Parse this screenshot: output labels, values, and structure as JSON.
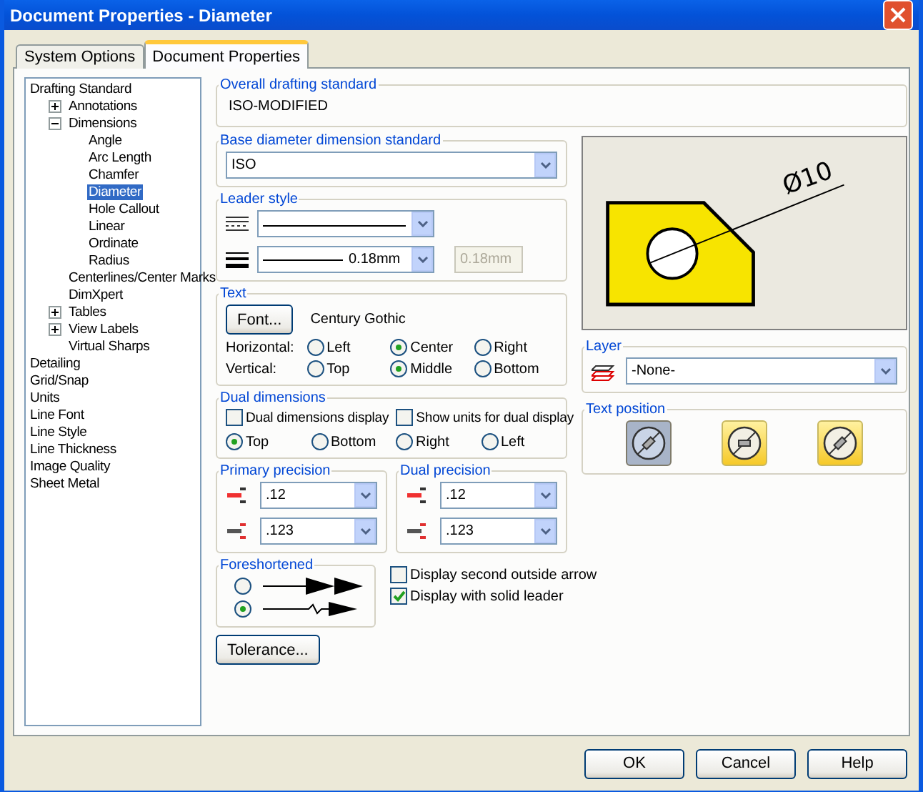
{
  "window": {
    "title": "Document Properties - Diameter"
  },
  "tabs": [
    {
      "label": "System Options",
      "selected": false
    },
    {
      "label": "Document Properties",
      "selected": true
    }
  ],
  "tree": [
    {
      "label": "Drafting Standard",
      "selected": false,
      "children": [
        {
          "label": "Annotations",
          "selected": false,
          "expanded": false
        },
        {
          "label": "Dimensions",
          "selected": false,
          "expanded": true,
          "children": [
            {
              "label": "Angle",
              "selected": false
            },
            {
              "label": "Arc Length",
              "selected": false
            },
            {
              "label": "Chamfer",
              "selected": false
            },
            {
              "label": "Diameter",
              "selected": true
            },
            {
              "label": "Hole Callout",
              "selected": false
            },
            {
              "label": "Linear",
              "selected": false
            },
            {
              "label": "Ordinate",
              "selected": false
            },
            {
              "label": "Radius",
              "selected": false
            }
          ]
        },
        {
          "label": "Centerlines/Center Marks",
          "selected": false
        },
        {
          "label": "DimXpert",
          "selected": false
        },
        {
          "label": "Tables",
          "selected": false,
          "expanded": false
        },
        {
          "label": "View Labels",
          "selected": false,
          "expanded": false
        },
        {
          "label": "Virtual Sharps",
          "selected": false
        }
      ]
    },
    {
      "label": "Detailing",
      "selected": false
    },
    {
      "label": "Grid/Snap",
      "selected": false
    },
    {
      "label": "Units",
      "selected": false
    },
    {
      "label": "Line Font",
      "selected": false
    },
    {
      "label": "Line Style",
      "selected": false
    },
    {
      "label": "Line Thickness",
      "selected": false
    },
    {
      "label": "Image Quality",
      "selected": false
    },
    {
      "label": "Sheet Metal",
      "selected": false
    }
  ],
  "overall_standard": {
    "label": "Overall drafting standard",
    "value": "ISO-MODIFIED"
  },
  "base_standard": {
    "label": "Base diameter dimension standard",
    "value": "ISO"
  },
  "leader_style": {
    "label": "Leader style",
    "thickness": "0.18mm",
    "custom_thickness": "0.18mm",
    "custom_disabled": true
  },
  "text": {
    "label": "Text",
    "font_button": "Font...",
    "font_name": "Century Gothic",
    "rows": [
      {
        "label": "Horizontal:",
        "options": [
          {
            "label": "Left",
            "selected": false
          },
          {
            "label": "Center",
            "selected": true
          },
          {
            "label": "Right",
            "selected": false
          }
        ]
      },
      {
        "label": "Vertical:",
        "options": [
          {
            "label": "Top",
            "selected": false
          },
          {
            "label": "Middle",
            "selected": true
          },
          {
            "label": "Bottom",
            "selected": false
          }
        ]
      }
    ]
  },
  "dual_dimensions": {
    "label": "Dual dimensions",
    "checkboxes": [
      {
        "label": "Dual dimensions display",
        "checked": false
      },
      {
        "label": "Show units for dual display",
        "checked": false
      }
    ],
    "options": [
      {
        "label": "Top",
        "selected": true
      },
      {
        "label": "Bottom",
        "selected": false
      },
      {
        "label": "Right",
        "selected": false
      },
      {
        "label": "Left",
        "selected": false
      }
    ]
  },
  "precision": [
    {
      "label": "Primary precision",
      "values": [
        ".12",
        ".123"
      ]
    },
    {
      "label": "Dual precision",
      "values": [
        ".12",
        ".123"
      ]
    }
  ],
  "foreshortened": {
    "label": "Foreshortened",
    "options": [
      {
        "kind": "straight",
        "selected": false
      },
      {
        "kind": "zigzag",
        "selected": true
      }
    ]
  },
  "arrow_options": [
    {
      "label": "Display second outside arrow",
      "checked": false
    },
    {
      "label": "Display with solid leader",
      "checked": true
    }
  ],
  "tolerance_button": "Tolerance...",
  "preview": {
    "dimension": "Ø10"
  },
  "layer": {
    "label": "Layer",
    "value": "-None-"
  },
  "text_position": {
    "label": "Text position",
    "options": [
      {
        "kind": "inline",
        "selected": true
      },
      {
        "kind": "horizontal",
        "selected": false
      },
      {
        "kind": "aligned",
        "selected": false
      }
    ]
  },
  "buttons": [
    "OK",
    "Cancel",
    "Help"
  ]
}
